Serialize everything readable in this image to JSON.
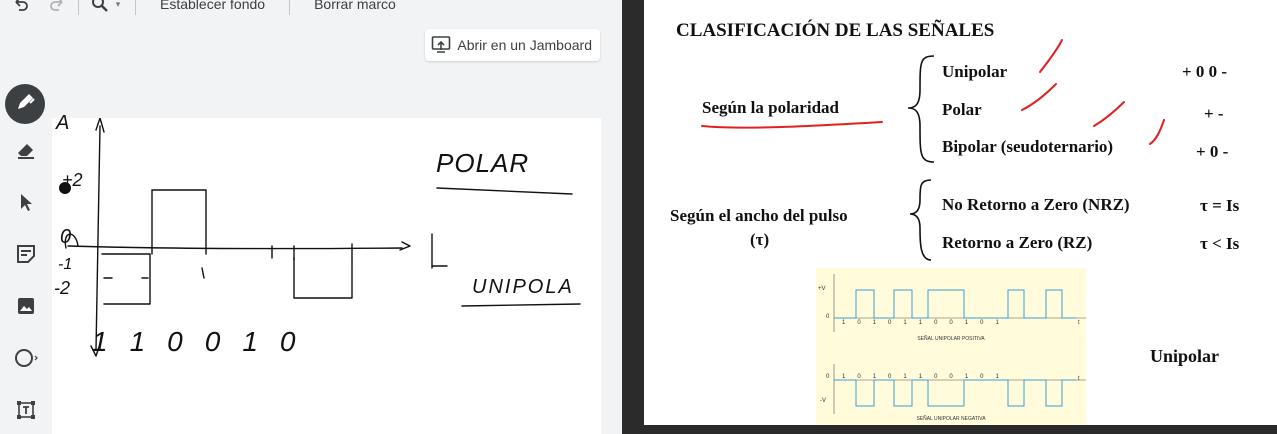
{
  "toolbar": {
    "set_background_label": "Establecer fondo",
    "delete_frame_label": "Borrar marco"
  },
  "open_jamboard": {
    "label": "Abrir en un Jamboard",
    "icon": "open-in-new-icon"
  },
  "tools": [
    "pen-icon",
    "eraser-icon",
    "select-arrow-icon",
    "sticky-note-icon",
    "image-icon",
    "circle-shape-icon",
    "text-box-icon"
  ],
  "drawing": {
    "y_axis_label": "A",
    "y_ticks": [
      "+2",
      "0",
      "-1",
      "-2"
    ],
    "t_label": "t",
    "title_polar": "POLAR",
    "title_unipolar": "UNIPOLA",
    "bits": [
      "1",
      "1",
      "0",
      "0",
      "1",
      "0"
    ]
  },
  "slide": {
    "title": "CLASIFICACIÓN DE LAS SEÑALES",
    "group1": {
      "label": "Según la polaridad",
      "items": [
        {
          "name": "Unipolar",
          "levels": "+ 0    0 -"
        },
        {
          "name": "Polar",
          "levels": "+  -"
        },
        {
          "name": "Bipolar (seudoternario)",
          "levels": "+ 0  -"
        }
      ]
    },
    "group2": {
      "label": "Según el ancho del pulso",
      "label_symbol": "(τ)",
      "items": [
        {
          "name": "No Retorno a Zero (NRZ)",
          "rel": "τ = Is"
        },
        {
          "name": "Retorno a Zero (RZ)",
          "rel": "τ < Is"
        }
      ]
    },
    "figure": {
      "positive_caption": "SEÑAL UNIPOLAR POSITIVA",
      "negative_caption": "SEÑAL UNIPOLAR NEGATIVA",
      "bits": [
        "1",
        "0",
        "1",
        "0",
        "1",
        "1",
        "0",
        "0",
        "1",
        "0",
        "1"
      ],
      "plus_v": "+V",
      "minus_v": "-V",
      "zero": "0",
      "t": "t"
    },
    "side_label": "Unipolar"
  },
  "colors": {
    "annotation_red": "#e02020",
    "figure_bg": "#fffbdb",
    "pulse": "#3aa0d8"
  }
}
